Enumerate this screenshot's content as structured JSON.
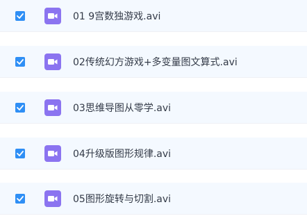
{
  "files": [
    {
      "name": "01 9宫数独游戏.avi",
      "checked": true,
      "icon": "video-file-icon"
    },
    {
      "name": "02传统幻方游戏+多变量图文算式.avi",
      "checked": true,
      "icon": "video-file-icon"
    },
    {
      "name": "03思维导图从零学.avi",
      "checked": true,
      "icon": "video-file-icon"
    },
    {
      "name": "04升级版图形规律.avi",
      "checked": true,
      "icon": "video-file-icon"
    },
    {
      "name": "05图形旋转与切割.avi",
      "checked": true,
      "icon": "video-file-icon"
    }
  ],
  "colors": {
    "row_background": "#f4f9ff",
    "checkbox": "#2f8ff5",
    "video_icon": "#8b74f0",
    "text": "#333a47"
  }
}
